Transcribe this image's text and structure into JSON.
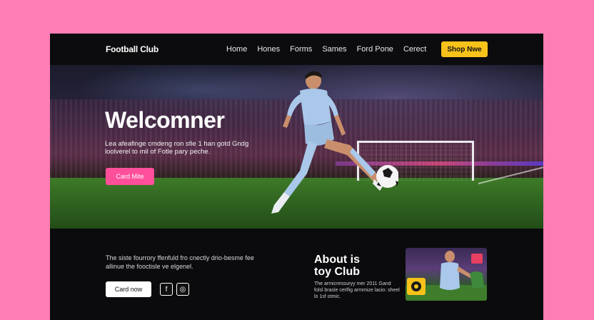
{
  "nav": {
    "brand": "Football Club",
    "items": [
      "Home",
      "Hones",
      "Forms",
      "Sames",
      "Ford Pone",
      "Cerect"
    ],
    "cta": "Shop Nwe"
  },
  "hero": {
    "title": "Welcomner",
    "subtitle": "Lea afeafingе cmdeng ron sfie 1 han gotd Gndg loolverеl to mil of Fotle pary peche.",
    "button": "Card Mite"
  },
  "bottom": {
    "text": "The siste fourrory ffenfuld fro cnectly drio-besme fee allinue the fooctisle ve elgenel.",
    "button": "Card now",
    "social": [
      "f",
      "◎"
    ],
    "about_title": "About is toy Club",
    "about_body": "The armicressuryy mer 2011 Gand folsl brasle cerlfig armmize lacio: sheel lo 1sf otmic."
  },
  "colors": {
    "background": "#ff7db5",
    "accent_yellow": "#f7c21a",
    "accent_pink": "#ff4f9b"
  }
}
